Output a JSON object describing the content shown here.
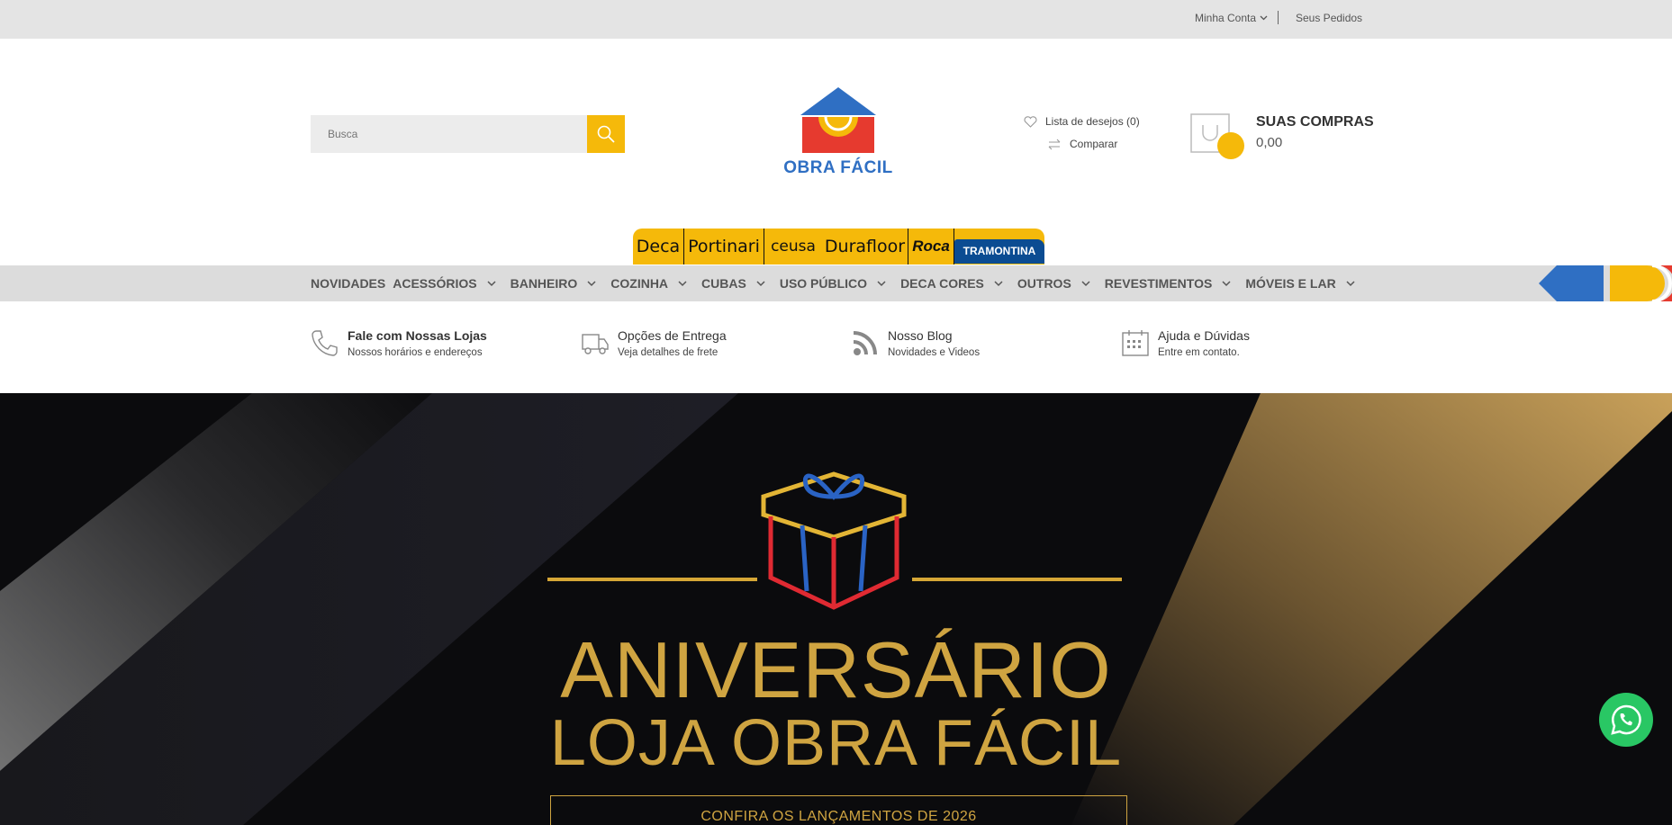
{
  "topbar": {
    "account_label": "Minha Conta",
    "orders_label": "Seus Pedidos"
  },
  "search": {
    "placeholder": "Busca"
  },
  "logo": {
    "text": "OBRA FÁCIL"
  },
  "header": {
    "wishlist_label": "Lista de desejos (0)",
    "compare_label": "Comparar",
    "cart_title": "SUAS COMPRAS",
    "cart_value": "0,00"
  },
  "brands": [
    "Deca",
    "Portinari",
    "ceusa",
    "Durafloor",
    "Roca",
    "TRAMONTINA"
  ],
  "nav": {
    "items": [
      {
        "label": "NOVIDADES",
        "has_dropdown": false
      },
      {
        "label": "ACESSÓRIOS",
        "has_dropdown": true
      },
      {
        "label": "BANHEIRO",
        "has_dropdown": true
      },
      {
        "label": "COZINHA",
        "has_dropdown": true
      },
      {
        "label": "CUBAS",
        "has_dropdown": true
      },
      {
        "label": "USO PÚBLICO",
        "has_dropdown": true
      },
      {
        "label": "DECA CORES",
        "has_dropdown": true
      },
      {
        "label": "OUTROS",
        "has_dropdown": true
      },
      {
        "label": "REVESTIMENTOS",
        "has_dropdown": true
      },
      {
        "label": "MÓVEIS E LAR",
        "has_dropdown": true
      }
    ]
  },
  "info": [
    {
      "title": "Fale com Nossas Lojas",
      "subtitle": "Nossos horários e endereços",
      "icon": "phone-icon"
    },
    {
      "title": "Opções de Entrega",
      "subtitle": "Veja detalhes de frete",
      "icon": "truck-icon"
    },
    {
      "title": "Nosso Blog",
      "subtitle": "Novidades e Videos",
      "icon": "rss-icon"
    },
    {
      "title": "Ajuda e Dúvidas",
      "subtitle": "Entre em contato.",
      "icon": "calendar-icon"
    }
  ],
  "hero": {
    "line1": "ANIVERSÁRIO",
    "line2": "LOJA OBRA FÁCIL",
    "cta": "CONFIRA OS LANÇAMENTOS DE 2026"
  },
  "colors": {
    "accent": "#f5b90a",
    "brand_blue": "#2f6fc3",
    "nav_bg": "#dcdcdc",
    "gold": "#cfa441",
    "whatsapp": "#29c764"
  }
}
